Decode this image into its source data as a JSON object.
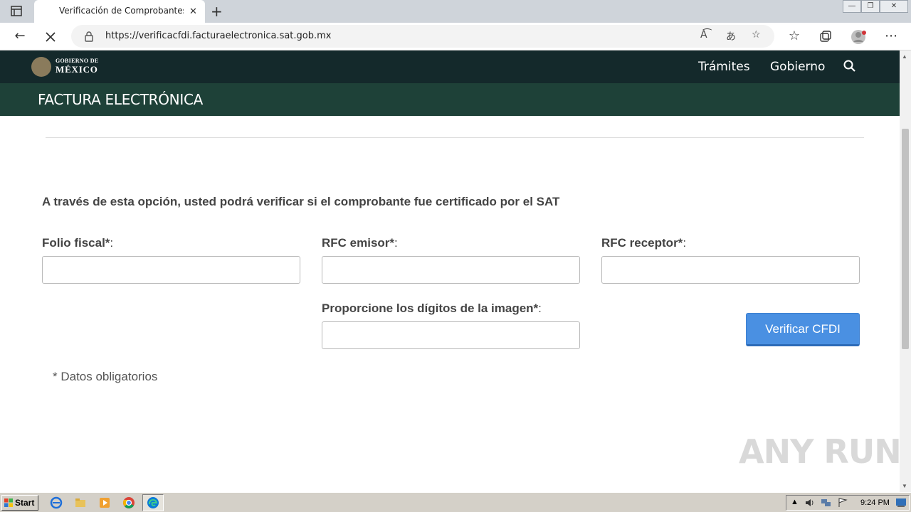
{
  "browser": {
    "tab_title": "Verificación de Comprobantes Fi",
    "tab_close": "✕",
    "new_tab": "+",
    "url_host": "https://verificacfdi.facturaelectronica.sat.gob.mx",
    "win_min": "—",
    "win_restore": "❐",
    "win_close": "✕"
  },
  "header": {
    "gov_line1": "GOBIERNO DE",
    "gov_line2": "MÉXICO",
    "nav_tramites": "Trámites",
    "nav_gobierno": "Gobierno",
    "section_title": "FACTURA ELECTRÓNICA"
  },
  "form": {
    "intro": "A través de esta opción, usted podrá verificar si el comprobante fue certificado por el SAT",
    "folio_label": "Folio fiscal*",
    "rfc_emisor_label": "RFC emisor*",
    "rfc_receptor_label": "RFC receptor*",
    "captcha_label": "Proporcione los dígitos de la imagen*",
    "colon": ":",
    "folio_value": "",
    "rfc_emisor_value": "",
    "rfc_receptor_value": "",
    "captcha_value": "",
    "submit_label": "Verificar CFDI",
    "required_note": "* Datos obligatorios"
  },
  "watermark": "ANY RUN",
  "taskbar": {
    "start_label": "Start",
    "clock": "9:24 PM"
  },
  "colors": {
    "header_dark": "#14292b",
    "subheader": "#1e4138",
    "button": "#4a90e2"
  }
}
